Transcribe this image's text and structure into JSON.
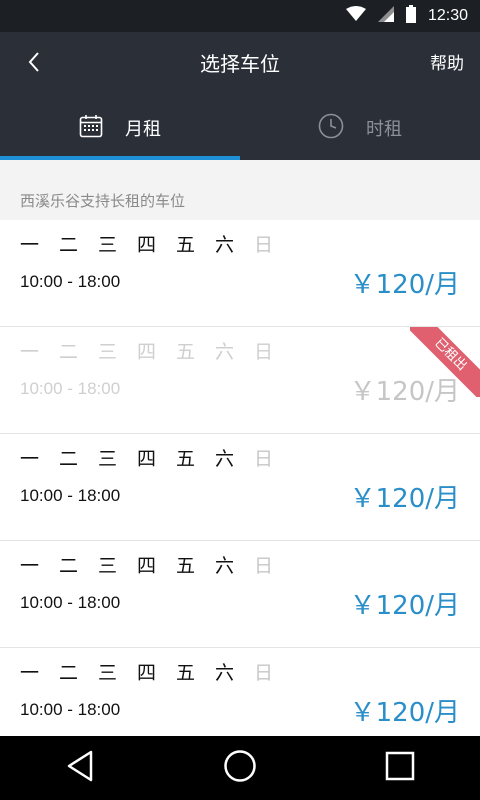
{
  "status_bar": {
    "time": "12:30"
  },
  "header": {
    "title": "选择车位",
    "help_label": "帮助"
  },
  "tabs": [
    {
      "label": "月租",
      "icon": "calendar-icon",
      "active": true
    },
    {
      "label": "时租",
      "icon": "clock-icon",
      "active": false
    }
  ],
  "section_title": "西溪乐谷支持长租的车位",
  "weekdays": [
    "一",
    "二",
    "三",
    "四",
    "五",
    "六",
    "日"
  ],
  "slots": [
    {
      "hours": "10:00 - 18:00",
      "price": "￥120/月",
      "rented": false
    },
    {
      "hours": "10:00 - 18:00",
      "price": "￥120/月",
      "rented": true,
      "badge": "已租出"
    },
    {
      "hours": "10:00 - 18:00",
      "price": "￥120/月",
      "rented": false
    },
    {
      "hours": "10:00 - 18:00",
      "price": "￥120/月",
      "rented": false
    },
    {
      "hours": "10:00 - 18:00",
      "price": "￥120/月",
      "rented": false
    }
  ],
  "colors": {
    "accent": "#1e90d6",
    "header_bg": "#2a2f38",
    "price": "#2a8fc9",
    "badge": "#e06070"
  }
}
